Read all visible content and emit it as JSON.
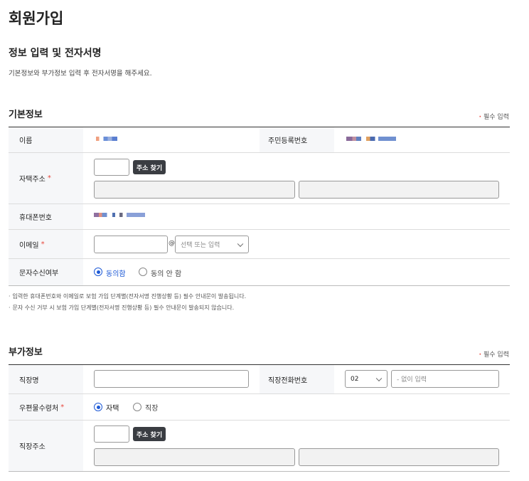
{
  "page": {
    "title": "회원가입",
    "subtitle": "정보 입력 및 전자서명",
    "description": "기본정보와 부가정보 입력 후 전자서명을 해주세요."
  },
  "basic": {
    "title": "기본정보",
    "required_note": "필수 입력",
    "name_label": "이름",
    "rrn_label": "주민등록번호",
    "address_label": "자택주소",
    "address_button": "주소 찾기",
    "phone_label": "휴대폰번호",
    "email_label": "이메일",
    "email_at": "@",
    "email_domain_placeholder": "선택 또는 입력",
    "sms_label": "문자수신여부",
    "sms_agree": "동의함",
    "sms_disagree": "동의 안 함",
    "notes": [
      "입력한 휴대폰번호와 이메일로 보험 가입 단계별(전자서명 진행상황 등) 필수 안내문이 발송됩니다.",
      "문자 수신 거부 시 보험 가입 단계별(전자서명 진행상황 등) 필수 안내문이 발송되지 않습니다."
    ]
  },
  "extra": {
    "title": "부가정보",
    "required_note": "필수 입력",
    "company_label": "직장명",
    "company_phone_label": "직장전화번호",
    "area_code": "02",
    "phone_placeholder": "- 없이 입력",
    "mail_label": "우편물수령처",
    "mail_home": "자택",
    "mail_work": "직장",
    "work_address_label": "직장주소",
    "address_button": "주소 찾기"
  },
  "colors": {
    "accent": "#1e5ad6",
    "required": "#e8473c",
    "button": "#3a3d42"
  }
}
